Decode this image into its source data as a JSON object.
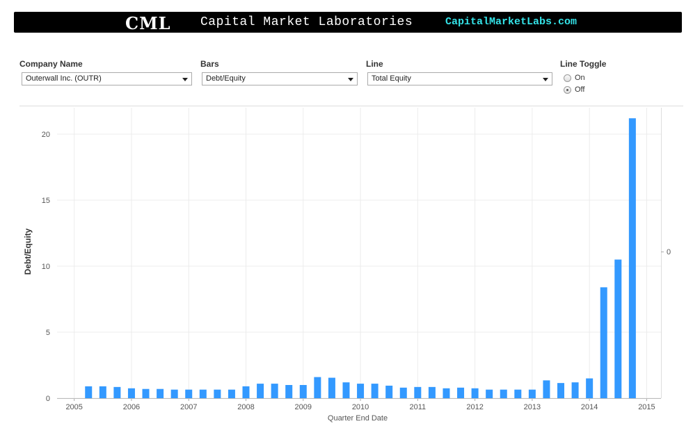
{
  "header": {
    "logo": "CML",
    "brand_name": "Capital Market Laboratories",
    "url": "CapitalMarketLabs.com",
    "background": "#000000",
    "url_color": "#34e3e8"
  },
  "controls": {
    "company": {
      "label": "Company Name",
      "value": "Outerwall Inc. (OUTR)"
    },
    "bars": {
      "label": "Bars",
      "value": "Debt/Equity"
    },
    "line": {
      "label": "Line",
      "value": "Total Equity"
    },
    "line_toggle": {
      "label": "Line Toggle",
      "options": [
        {
          "label": "On",
          "checked": false
        },
        {
          "label": "Off",
          "checked": true
        }
      ]
    }
  },
  "chart_data": {
    "type": "bar",
    "xlabel": "Quarter End Date",
    "ylabel": "Debt/Equity",
    "ylim": [
      0,
      22
    ],
    "xlim": [
      2004.7,
      2015.25
    ],
    "y_ticks": [
      0,
      5,
      10,
      15,
      20
    ],
    "x_ticks": [
      2005,
      2006,
      2007,
      2008,
      2009,
      2010,
      2011,
      2012,
      2013,
      2014,
      2015
    ],
    "secondary_axis_label": "0",
    "bar_color": "#3399ff",
    "grid": true,
    "x": [
      2005.25,
      2005.5,
      2005.75,
      2006.0,
      2006.25,
      2006.5,
      2006.75,
      2007.0,
      2007.25,
      2007.5,
      2007.75,
      2008.0,
      2008.25,
      2008.5,
      2008.75,
      2009.0,
      2009.25,
      2009.5,
      2009.75,
      2010.0,
      2010.25,
      2010.5,
      2010.75,
      2011.0,
      2011.25,
      2011.5,
      2011.75,
      2012.0,
      2012.25,
      2012.5,
      2012.75,
      2013.0,
      2013.25,
      2013.5,
      2013.75,
      2014.0,
      2014.25,
      2014.5,
      2014.75
    ],
    "values": [
      0.9,
      0.9,
      0.85,
      0.75,
      0.7,
      0.7,
      0.65,
      0.65,
      0.65,
      0.65,
      0.65,
      0.9,
      1.1,
      1.1,
      1.0,
      1.0,
      1.6,
      1.55,
      1.2,
      1.1,
      1.1,
      0.95,
      0.8,
      0.85,
      0.85,
      0.75,
      0.8,
      0.75,
      0.65,
      0.65,
      0.65,
      0.65,
      1.35,
      1.15,
      1.2,
      1.5,
      8.4,
      10.5,
      21.2
    ]
  }
}
